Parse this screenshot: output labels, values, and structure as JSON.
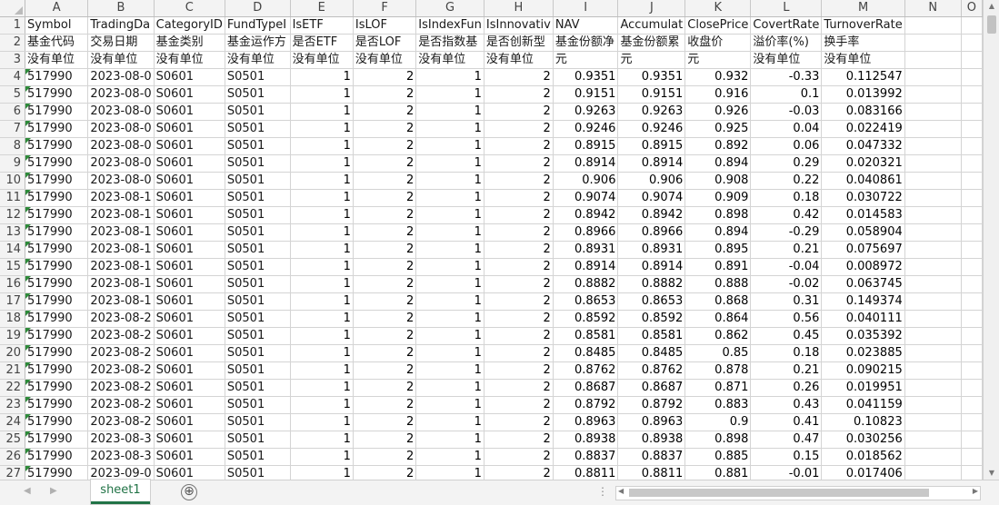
{
  "columns": [
    "A",
    "B",
    "C",
    "D",
    "E",
    "F",
    "G",
    "H",
    "I",
    "J",
    "K",
    "L",
    "M",
    "N",
    "O"
  ],
  "header_rows": [
    [
      "Symbol",
      "TradingDa",
      "CategoryID",
      "FundTypeI",
      "IsETF",
      "IsLOF",
      "IsIndexFun",
      "IsInnovativ",
      "NAV",
      "Accumulat",
      "ClosePrice",
      "CovertRate",
      "TurnoverRate",
      "",
      ""
    ],
    [
      "基金代码",
      "交易日期",
      "基金类别",
      "基金运作方",
      "是否ETF",
      "是否LOF",
      "是否指数基",
      "是否创新型",
      "基金份额净",
      "基金份额累",
      "收盘价",
      "溢价率(%)",
      "换手率",
      "",
      ""
    ],
    [
      "没有单位",
      "没有单位",
      "没有单位",
      "没有单位",
      "没有单位",
      "没有单位",
      "没有单位",
      "没有单位",
      "元",
      "元",
      "元",
      "没有单位",
      "没有单位",
      "",
      ""
    ]
  ],
  "data_rows": [
    [
      "517990",
      "2023-08-0",
      "S0601",
      "S0501",
      "1",
      "2",
      "1",
      "2",
      "0.9351",
      "0.9351",
      "0.932",
      "-0.33",
      "0.112547"
    ],
    [
      "517990",
      "2023-08-0",
      "S0601",
      "S0501",
      "1",
      "2",
      "1",
      "2",
      "0.9151",
      "0.9151",
      "0.916",
      "0.1",
      "0.013992"
    ],
    [
      "517990",
      "2023-08-0",
      "S0601",
      "S0501",
      "1",
      "2",
      "1",
      "2",
      "0.9263",
      "0.9263",
      "0.926",
      "-0.03",
      "0.083166"
    ],
    [
      "517990",
      "2023-08-0",
      "S0601",
      "S0501",
      "1",
      "2",
      "1",
      "2",
      "0.9246",
      "0.9246",
      "0.925",
      "0.04",
      "0.022419"
    ],
    [
      "517990",
      "2023-08-0",
      "S0601",
      "S0501",
      "1",
      "2",
      "1",
      "2",
      "0.8915",
      "0.8915",
      "0.892",
      "0.06",
      "0.047332"
    ],
    [
      "517990",
      "2023-08-0",
      "S0601",
      "S0501",
      "1",
      "2",
      "1",
      "2",
      "0.8914",
      "0.8914",
      "0.894",
      "0.29",
      "0.020321"
    ],
    [
      "517990",
      "2023-08-0",
      "S0601",
      "S0501",
      "1",
      "2",
      "1",
      "2",
      "0.906",
      "0.906",
      "0.908",
      "0.22",
      "0.040861"
    ],
    [
      "517990",
      "2023-08-1",
      "S0601",
      "S0501",
      "1",
      "2",
      "1",
      "2",
      "0.9074",
      "0.9074",
      "0.909",
      "0.18",
      "0.030722"
    ],
    [
      "517990",
      "2023-08-1",
      "S0601",
      "S0501",
      "1",
      "2",
      "1",
      "2",
      "0.8942",
      "0.8942",
      "0.898",
      "0.42",
      "0.014583"
    ],
    [
      "517990",
      "2023-08-1",
      "S0601",
      "S0501",
      "1",
      "2",
      "1",
      "2",
      "0.8966",
      "0.8966",
      "0.894",
      "-0.29",
      "0.058904"
    ],
    [
      "517990",
      "2023-08-1",
      "S0601",
      "S0501",
      "1",
      "2",
      "1",
      "2",
      "0.8931",
      "0.8931",
      "0.895",
      "0.21",
      "0.075697"
    ],
    [
      "517990",
      "2023-08-1",
      "S0601",
      "S0501",
      "1",
      "2",
      "1",
      "2",
      "0.8914",
      "0.8914",
      "0.891",
      "-0.04",
      "0.008972"
    ],
    [
      "517990",
      "2023-08-1",
      "S0601",
      "S0501",
      "1",
      "2",
      "1",
      "2",
      "0.8882",
      "0.8882",
      "0.888",
      "-0.02",
      "0.063745"
    ],
    [
      "517990",
      "2023-08-1",
      "S0601",
      "S0501",
      "1",
      "2",
      "1",
      "2",
      "0.8653",
      "0.8653",
      "0.868",
      "0.31",
      "0.149374"
    ],
    [
      "517990",
      "2023-08-2",
      "S0601",
      "S0501",
      "1",
      "2",
      "1",
      "2",
      "0.8592",
      "0.8592",
      "0.864",
      "0.56",
      "0.040111"
    ],
    [
      "517990",
      "2023-08-2",
      "S0601",
      "S0501",
      "1",
      "2",
      "1",
      "2",
      "0.8581",
      "0.8581",
      "0.862",
      "0.45",
      "0.035392"
    ],
    [
      "517990",
      "2023-08-2",
      "S0601",
      "S0501",
      "1",
      "2",
      "1",
      "2",
      "0.8485",
      "0.8485",
      "0.85",
      "0.18",
      "0.023885"
    ],
    [
      "517990",
      "2023-08-2",
      "S0601",
      "S0501",
      "1",
      "2",
      "1",
      "2",
      "0.8762",
      "0.8762",
      "0.878",
      "0.21",
      "0.090215"
    ],
    [
      "517990",
      "2023-08-2",
      "S0601",
      "S0501",
      "1",
      "2",
      "1",
      "2",
      "0.8687",
      "0.8687",
      "0.871",
      "0.26",
      "0.019951"
    ],
    [
      "517990",
      "2023-08-2",
      "S0601",
      "S0501",
      "1",
      "2",
      "1",
      "2",
      "0.8792",
      "0.8792",
      "0.883",
      "0.43",
      "0.041159"
    ],
    [
      "517990",
      "2023-08-2",
      "S0601",
      "S0501",
      "1",
      "2",
      "1",
      "2",
      "0.8963",
      "0.8963",
      "0.9",
      "0.41",
      "0.10823"
    ],
    [
      "517990",
      "2023-08-3",
      "S0601",
      "S0501",
      "1",
      "2",
      "1",
      "2",
      "0.8938",
      "0.8938",
      "0.898",
      "0.47",
      "0.030256"
    ],
    [
      "517990",
      "2023-08-3",
      "S0601",
      "S0501",
      "1",
      "2",
      "1",
      "2",
      "0.8837",
      "0.8837",
      "0.885",
      "0.15",
      "0.018562"
    ],
    [
      "517990",
      "2023-09-0",
      "S0601",
      "S0501",
      "1",
      "2",
      "1",
      "2",
      "0.8811",
      "0.8811",
      "0.881",
      "-0.01",
      "0.017406"
    ]
  ],
  "first_row_number": 1,
  "sheet_tab": "sheet1",
  "add_sheet": "⊕",
  "colors": {
    "accent": "#217346",
    "flag": "#2e8b3a"
  }
}
